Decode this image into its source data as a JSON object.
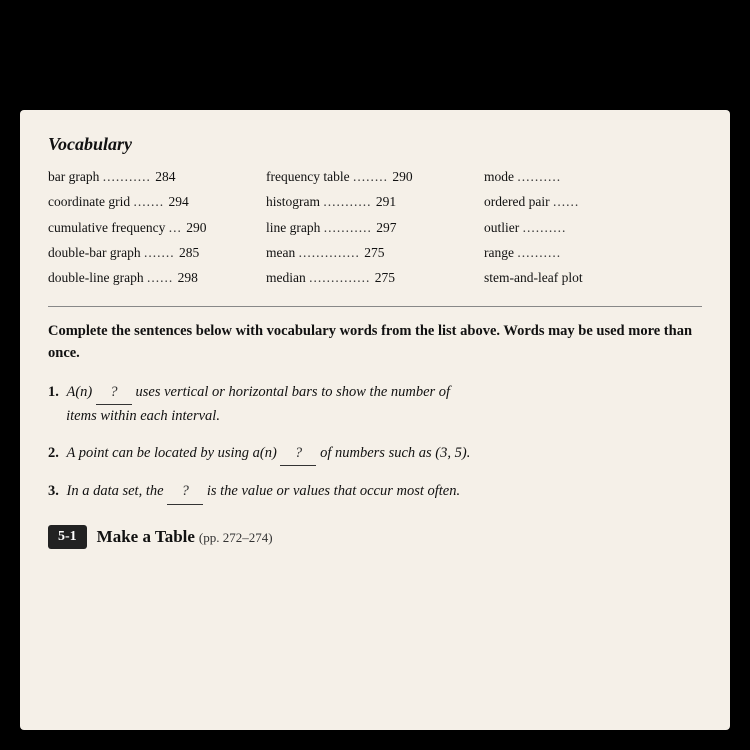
{
  "header": {
    "title": "Vocabulary"
  },
  "vocab": {
    "col1": [
      {
        "term": "bar graph",
        "dots": "...........",
        "page": "284"
      },
      {
        "term": "coordinate grid",
        "dots": ".......",
        "page": "294"
      },
      {
        "term": "cumulative frequency",
        "dots": "...",
        "page": "290"
      },
      {
        "term": "double-bar graph",
        "dots": ".......",
        "page": "285"
      },
      {
        "term": "double-line graph",
        "dots": "....",
        "page": "298"
      }
    ],
    "col2": [
      {
        "term": "frequency table",
        "dots": ".......",
        "page": "290"
      },
      {
        "term": "histogram",
        "dots": "..........",
        "page": "291"
      },
      {
        "term": "line graph",
        "dots": "..........",
        "page": "297"
      },
      {
        "term": "mean",
        "dots": ".............",
        "page": "275"
      },
      {
        "term": "median",
        "dots": ".............",
        "page": "275"
      }
    ],
    "col3": [
      {
        "term": "mode",
        "dots": ".........."
      },
      {
        "term": "ordered pair",
        "dots": "......"
      },
      {
        "term": "outlier",
        "dots": ".........."
      },
      {
        "term": "range",
        "dots": ".........."
      },
      {
        "term": "stem-and-leaf plot",
        "dots": ""
      }
    ]
  },
  "instructions": "Complete the sentences below with vocabulary words from the list above. Words may be used more than once.",
  "questions": [
    {
      "num": "1.",
      "italic": true,
      "text_before": "A(n)",
      "blank": "?",
      "text_after": "uses vertical or horizontal bars to show the number of items within each interval."
    },
    {
      "num": "2.",
      "italic": true,
      "text_before": "A point can be located by using a(n)",
      "blank": "?",
      "text_after": "of numbers such as (3, 5)."
    },
    {
      "num": "3.",
      "italic": true,
      "text_before": "In a data set, the",
      "blank": "?",
      "text_after": "is the value or values that occur most often."
    }
  ],
  "footer": {
    "badge": "5-1",
    "title": "Make a Table",
    "pages": "(pp. 272–274)"
  }
}
